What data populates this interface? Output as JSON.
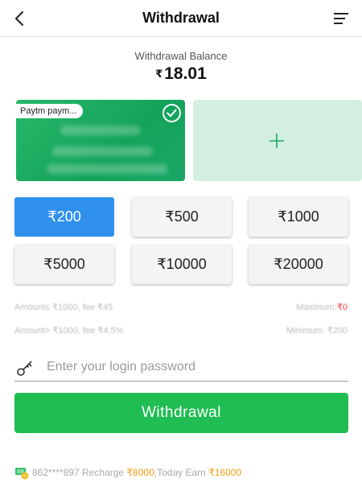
{
  "header": {
    "title": "Withdrawal",
    "back_icon": "chevron-left-icon",
    "menu_icon": "menu-lines-icon"
  },
  "balance": {
    "label": "Withdrawal Balance",
    "currency": "₹",
    "amount": "18.01"
  },
  "cards": {
    "selected_label": "Paytm paym...",
    "check_icon": "check-circle-icon",
    "add_icon": "plus-icon"
  },
  "amounts": [
    {
      "label": "₹200",
      "active": true
    },
    {
      "label": "₹500",
      "active": false
    },
    {
      "label": "₹1000",
      "active": false
    },
    {
      "label": "₹5000",
      "active": false
    },
    {
      "label": "₹10000",
      "active": false
    },
    {
      "label": "₹20000",
      "active": false
    }
  ],
  "limits": {
    "fee_line_1": "Amount≤ ₹1000, fee ₹45",
    "max_label": "Maximum:",
    "max_value": "₹0",
    "fee_line_2": "Amount> ₹1000, fee ₹4.5%",
    "min_text": "Minimum: ₹200"
  },
  "password": {
    "placeholder": "Enter your login password",
    "value": "",
    "icon": "key-icon"
  },
  "submit": {
    "label": "Withdrawal"
  },
  "ticker": {
    "icon": "cash-coin-icon",
    "prefix": "862****897 Recharge ",
    "recharge_amount": "₹8000",
    "middle": ",Today Earn ",
    "earn_amount": "₹16000"
  },
  "colors": {
    "accent_blue": "#2f91ec",
    "green_button": "#1fbd52",
    "card_green": "#1aa764",
    "max_red": "#e53935",
    "highlight_orange": "#f39c12"
  }
}
